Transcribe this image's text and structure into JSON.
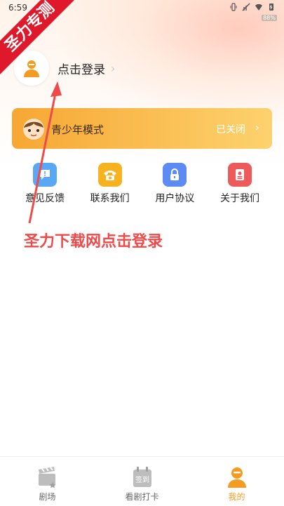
{
  "status_bar": {
    "time": "6:59",
    "battery_tag": "88%"
  },
  "watermark": {
    "text": "圣力专测"
  },
  "login": {
    "label": "点击登录"
  },
  "teen_mode": {
    "title": "青少年模式",
    "status": "已关闭"
  },
  "quick_actions": [
    {
      "label": "意见反馈",
      "icon": "feedback-icon",
      "color": "#5aa7f5"
    },
    {
      "label": "联系我们",
      "icon": "phone-icon",
      "color": "#f6b21f"
    },
    {
      "label": "用户协议",
      "icon": "lock-icon",
      "color": "#5d8bf4"
    },
    {
      "label": "关于我们",
      "icon": "about-icon",
      "color": "#ee5a5a"
    }
  ],
  "annotation": {
    "text": "圣力下载网点击登录"
  },
  "tabbar": {
    "items": [
      {
        "label": "剧场",
        "icon": "clapperboard-icon"
      },
      {
        "label": "看剧打卡",
        "icon": "checkin-calendar-icon",
        "badge": "签到"
      },
      {
        "label": "我的",
        "icon": "profile-icon"
      }
    ]
  },
  "colors": {
    "accent": "#f49c22",
    "annotation": "#ef4a4a",
    "watermark": "#e0182c"
  }
}
